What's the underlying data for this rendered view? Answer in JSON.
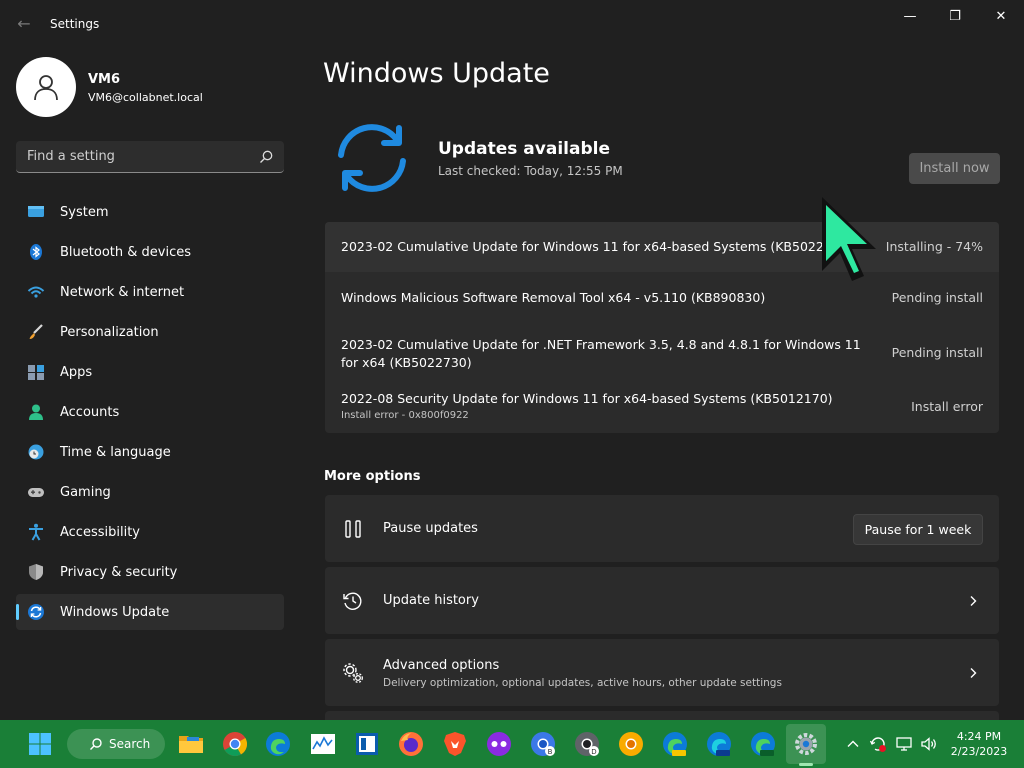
{
  "window": {
    "title": "Settings",
    "controls": {
      "minimize": "—",
      "restore": "❐",
      "close": "✕"
    },
    "back_glyph": "←"
  },
  "user": {
    "name": "VM6",
    "email": "VM6@collabnet.local"
  },
  "search": {
    "placeholder": "Find a setting"
  },
  "sidebar": {
    "items": [
      {
        "label": "System",
        "icon": "monitor-icon",
        "active": false
      },
      {
        "label": "Bluetooth & devices",
        "icon": "bluetooth-icon",
        "active": false
      },
      {
        "label": "Network & internet",
        "icon": "wifi-icon",
        "active": false
      },
      {
        "label": "Personalization",
        "icon": "brush-icon",
        "active": false
      },
      {
        "label": "Apps",
        "icon": "apps-icon",
        "active": false
      },
      {
        "label": "Accounts",
        "icon": "person-icon",
        "active": false
      },
      {
        "label": "Time & language",
        "icon": "globe-clock-icon",
        "active": false
      },
      {
        "label": "Gaming",
        "icon": "gamepad-icon",
        "active": false
      },
      {
        "label": "Accessibility",
        "icon": "accessibility-icon",
        "active": false
      },
      {
        "label": "Privacy & security",
        "icon": "shield-icon",
        "active": false
      },
      {
        "label": "Windows Update",
        "icon": "windows-update-icon",
        "active": true
      }
    ]
  },
  "main": {
    "title": "Windows Update",
    "status": {
      "title": "Updates available",
      "last_checked": "Last checked: Today, 12:55 PM",
      "install_button": "Install now"
    },
    "updates": [
      {
        "name": "2023-02 Cumulative Update for Windows 11 for x64-based Systems (KB5022845)",
        "status": "Installing - 74%",
        "progress_percent": 74,
        "detail": ""
      },
      {
        "name": "Windows Malicious Software Removal Tool x64 - v5.110 (KB890830)",
        "status": "Pending install",
        "detail": ""
      },
      {
        "name": "2023-02 Cumulative Update for .NET Framework 3.5, 4.8 and 4.8.1 for Windows 11 for x64 (KB5022730)",
        "status": "Pending install",
        "detail": ""
      },
      {
        "name": "2022-08 Security Update for Windows 11 for x64-based Systems (KB5012170)",
        "status": "Install error",
        "detail": "Install error - 0x800f0922"
      }
    ],
    "more_options": {
      "title": "More options",
      "pause": {
        "label": "Pause updates",
        "button": "Pause for 1 week"
      },
      "history": {
        "label": "Update history"
      },
      "advanced": {
        "label": "Advanced options",
        "sub": "Delivery optimization, optional updates, active hours, other update settings"
      }
    }
  },
  "taskbar": {
    "search_label": "Search",
    "apps": [
      "windows-start-icon",
      "file-explorer-icon",
      "chrome-icon",
      "edge-icon",
      "resource-monitor-icon",
      "paint-icon",
      "firefox-icon",
      "brave-icon",
      "private-browser-icon",
      "chrome-beta-icon",
      "chrome-dev-icon",
      "chrome-canary-icon",
      "edge-canary-icon",
      "edge-beta-icon",
      "edge-dev-icon",
      "settings-icon"
    ],
    "clock": {
      "time": "4:24 PM",
      "date": "2/23/2023"
    }
  },
  "colors": {
    "background": "#202020",
    "card": "#2b2b2b",
    "accent": "#60cdff",
    "taskbar": "#1a7f37",
    "cursor": "#2ee8a0"
  }
}
